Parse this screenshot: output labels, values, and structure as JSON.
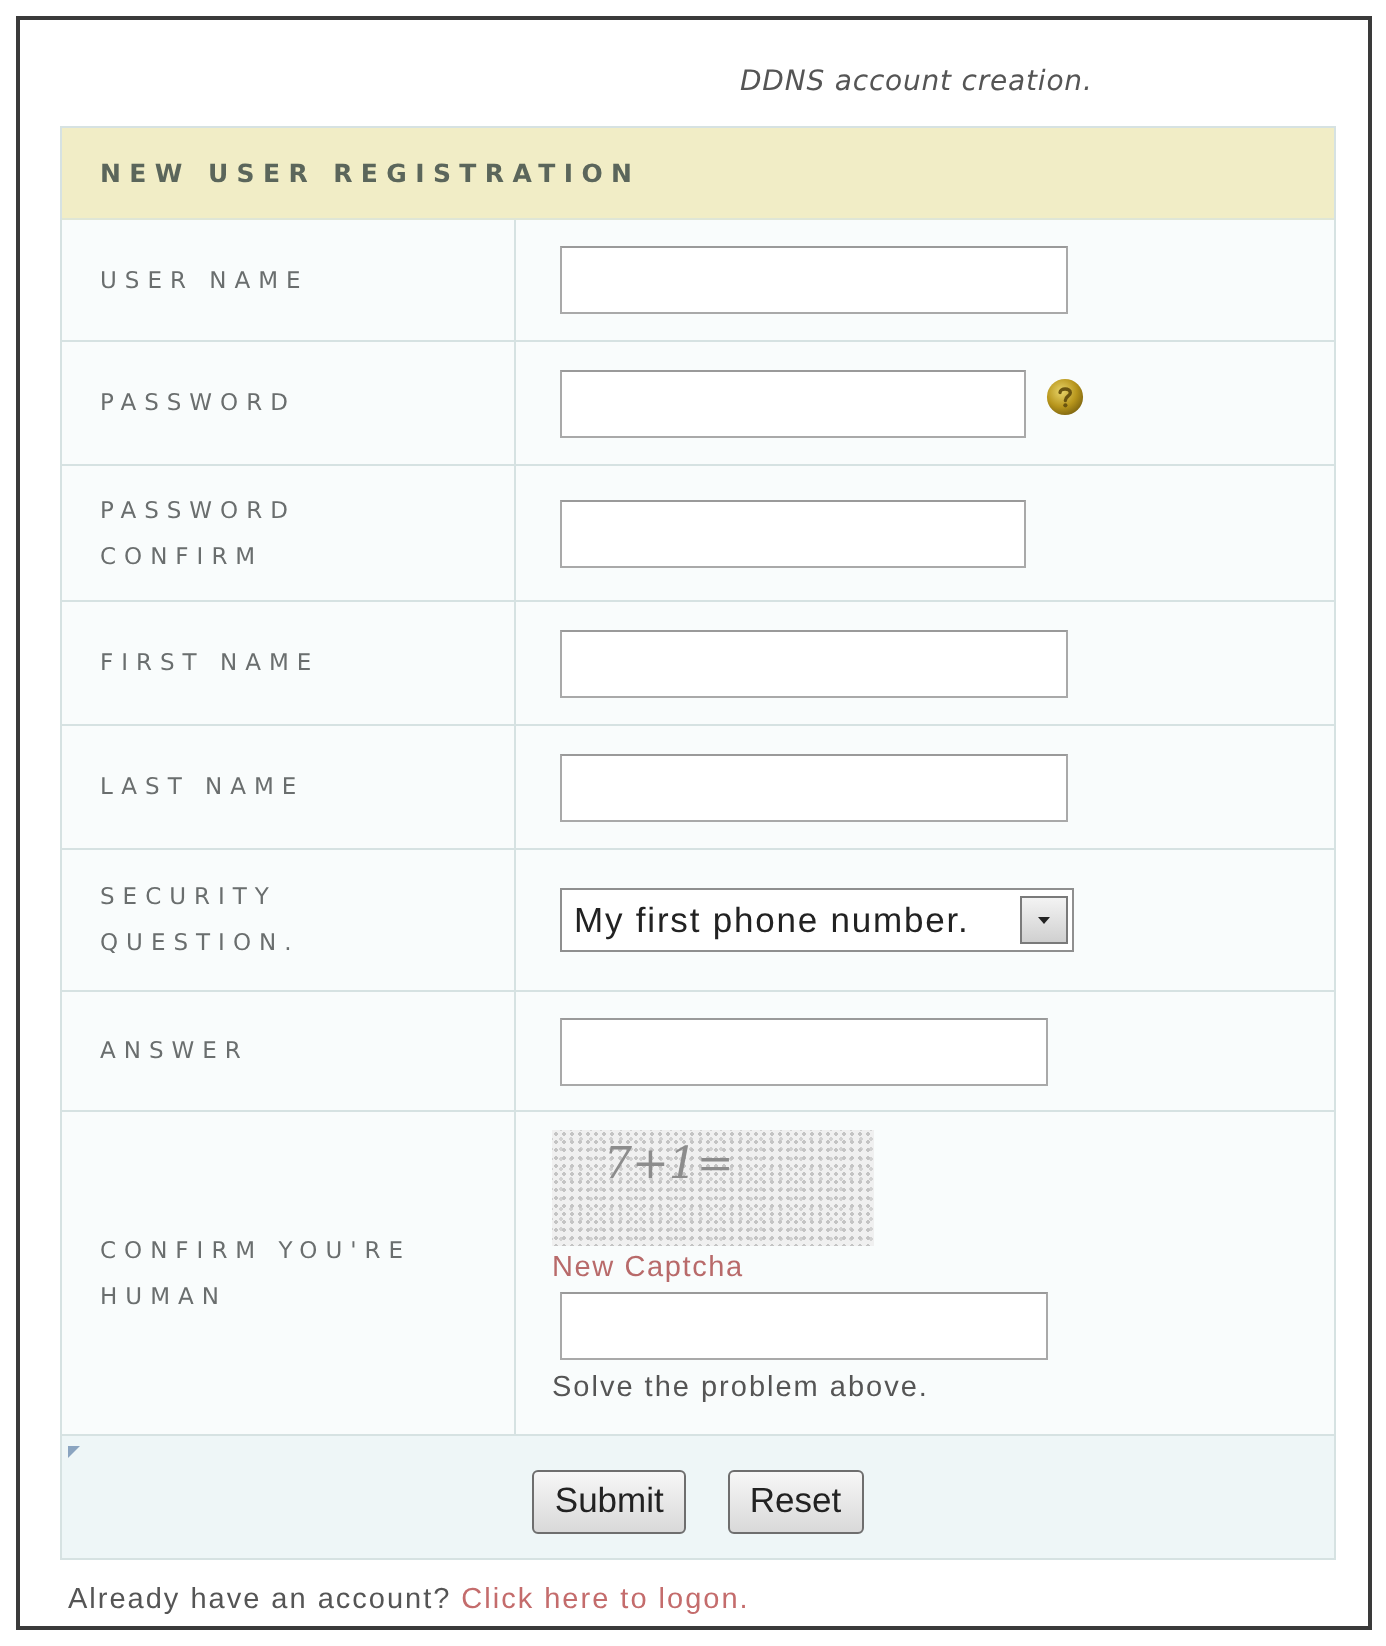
{
  "caption": "DDNS account creation.",
  "form": {
    "title": "NEW USER REGISTRATION",
    "fields": [
      {
        "kind": "text",
        "label": "USER NAME",
        "help": false
      },
      {
        "kind": "password",
        "label": "PASSWORD",
        "help": true
      },
      {
        "kind": "password",
        "label": "PASSWORD CONFIRM",
        "help": false
      },
      {
        "kind": "text",
        "label": "FIRST NAME",
        "help": false
      },
      {
        "kind": "text",
        "label": "LAST NAME",
        "help": false
      },
      {
        "kind": "select",
        "label": "SECURITY QUESTION.",
        "value": "My first phone number.",
        "help": false
      },
      {
        "kind": "text",
        "label": "ANSWER",
        "help": false
      },
      {
        "kind": "captcha",
        "label": "CONFIRM YOU'RE HUMAN",
        "captcha_text": "7+1=",
        "link": "New Captcha",
        "hint": "Solve the problem above.",
        "help": false
      }
    ],
    "buttons": [
      "Submit",
      "Reset"
    ]
  },
  "footer": {
    "text": "Already have an account?",
    "link": "Click here to logon."
  }
}
